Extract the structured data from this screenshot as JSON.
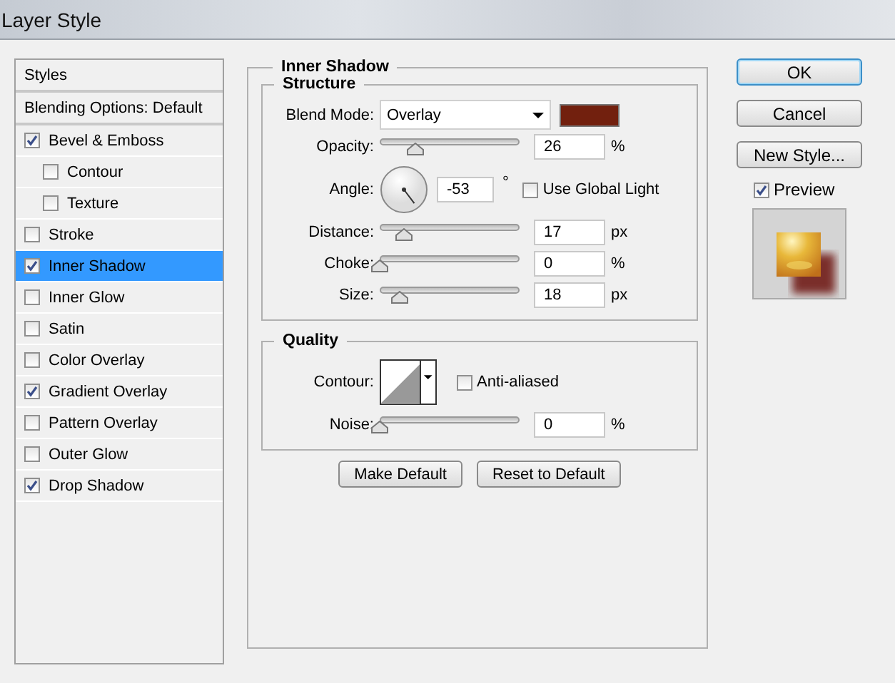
{
  "window": {
    "title": "Layer Style"
  },
  "sidebar": {
    "items": [
      {
        "kind": "header",
        "label": "Styles",
        "selected": false
      },
      {
        "kind": "header",
        "label": "Blending Options: Default",
        "selected": false
      },
      {
        "kind": "effect",
        "label": "Bevel & Emboss",
        "checked": true,
        "selected": false,
        "children": [
          {
            "kind": "effect",
            "label": "Contour",
            "checked": false,
            "selected": false
          },
          {
            "kind": "effect",
            "label": "Texture",
            "checked": false,
            "selected": false
          }
        ]
      },
      {
        "kind": "effect",
        "label": "Stroke",
        "checked": false,
        "selected": false
      },
      {
        "kind": "effect",
        "label": "Inner Shadow",
        "checked": true,
        "selected": true
      },
      {
        "kind": "effect",
        "label": "Inner Glow",
        "checked": false,
        "selected": false
      },
      {
        "kind": "effect",
        "label": "Satin",
        "checked": false,
        "selected": false
      },
      {
        "kind": "effect",
        "label": "Color Overlay",
        "checked": false,
        "selected": false
      },
      {
        "kind": "effect",
        "label": "Gradient Overlay",
        "checked": true,
        "selected": false
      },
      {
        "kind": "effect",
        "label": "Pattern Overlay",
        "checked": false,
        "selected": false
      },
      {
        "kind": "effect",
        "label": "Outer Glow",
        "checked": false,
        "selected": false
      },
      {
        "kind": "effect",
        "label": "Drop Shadow",
        "checked": true,
        "selected": false
      }
    ]
  },
  "panel": {
    "title": "Inner Shadow",
    "groups": [
      {
        "title": "Structure",
        "rows": [
          {
            "kind": "blend",
            "label": "Blend Mode:",
            "value": "Overlay",
            "color": "#72200e"
          },
          {
            "kind": "slider",
            "label": "Opacity:",
            "level": 0.26,
            "value": "26",
            "unit": "%"
          },
          {
            "kind": "angle",
            "label": "Angle:",
            "value": "-53",
            "unit": "°",
            "checkbox": {
              "label": "Use Global Light",
              "checked": false
            }
          },
          {
            "kind": "slider",
            "label": "Distance:",
            "level": 0.17,
            "value": "17",
            "unit": "px"
          },
          {
            "kind": "slider",
            "label": "Choke:",
            "level": 0,
            "value": "0",
            "unit": "%"
          },
          {
            "kind": "slider",
            "label": "Size:",
            "level": 0.14,
            "value": "18",
            "unit": "px"
          }
        ]
      },
      {
        "title": "Quality",
        "rows": [
          {
            "kind": "contour",
            "label": "Contour:",
            "checkbox": {
              "label": "Anti-aliased",
              "checked": false
            }
          },
          {
            "kind": "slider",
            "label": "Noise:",
            "level": 0,
            "value": "0",
            "unit": "%"
          }
        ]
      }
    ],
    "buttons": [
      "Make Default",
      "Reset to Default"
    ]
  },
  "actions": {
    "buttons": [
      {
        "label": "OK",
        "default": true
      },
      {
        "label": "Cancel",
        "default": false
      },
      {
        "label": "New Style...",
        "default": false
      }
    ],
    "preview": {
      "label": "Preview",
      "checked": true
    }
  }
}
